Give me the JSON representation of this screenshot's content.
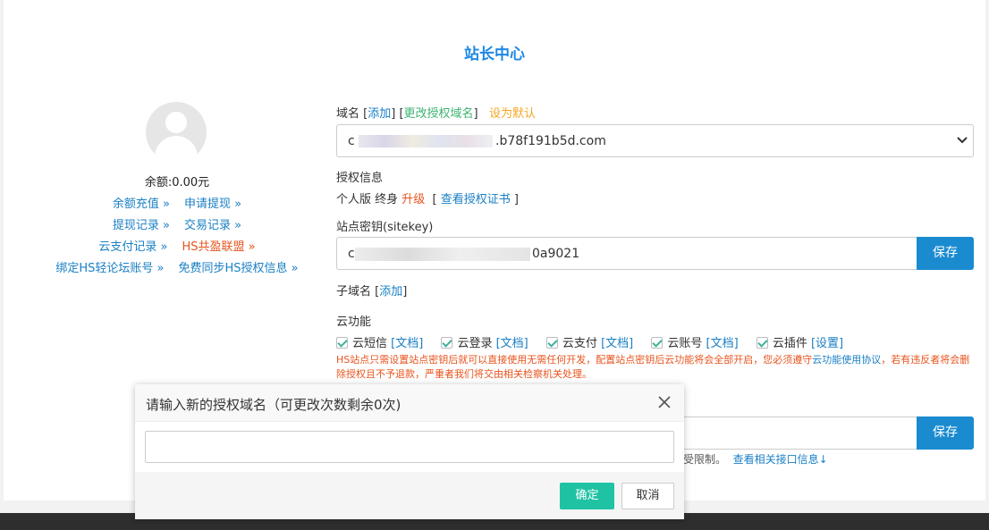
{
  "page": {
    "title": "站长中心"
  },
  "account": {
    "balance": "余额:0.00元",
    "links": [
      [
        "余额充值 »",
        "申请提现 »"
      ],
      [
        "提现记录 »",
        "交易记录 »"
      ],
      [
        "云支付记录 »",
        "HS共盈联盟 »"
      ],
      [
        "绑定HS轻论坛账号 »",
        "免费同步HS授权信息 »"
      ]
    ]
  },
  "domain": {
    "label": "域名",
    "add": "添加",
    "change": "更改授权域名",
    "set_default": "设为默认",
    "value_prefix": "c",
    "value_suffix": ".b78f191b5d.com"
  },
  "license": {
    "label": "授权信息",
    "edition": "个人版 终身",
    "upgrade": "升级",
    "view_cert": "查看授权证书"
  },
  "sitekey": {
    "label": "站点密钥(sitekey)",
    "value_prefix": "c",
    "value_suffix": "0a9021",
    "save": "保存"
  },
  "subdomain": {
    "label": "子域名",
    "add": "添加"
  },
  "cloud": {
    "label": "云功能",
    "items": [
      {
        "name": "云短信",
        "link": "[文档]"
      },
      {
        "name": "云登录",
        "link": "[文档]"
      },
      {
        "name": "云支付",
        "link": "[文档]"
      },
      {
        "name": "云账号",
        "link": "[文档]"
      },
      {
        "name": "云插件",
        "link": "[设置]"
      }
    ],
    "warning_part1": "HS站点只需设置站点密钥后就可以直接使用无需任何开发，配置站点密钥后云功能将会全部开启，您必须遵守",
    "warning_link": "云功能使用协议",
    "warning_part2": "，若有违反者将会删除授权且不予退款，严重者我们将交由相关检察机关处理。"
  },
  "api": {
    "save": "保存",
    "note_tail": "受限制。",
    "note_link": "查看相关接口信息↓"
  },
  "dialog": {
    "title": "请输入新的授权域名（可更改次数剩余0次)",
    "input_value": "",
    "ok": "确定",
    "cancel": "取消"
  }
}
